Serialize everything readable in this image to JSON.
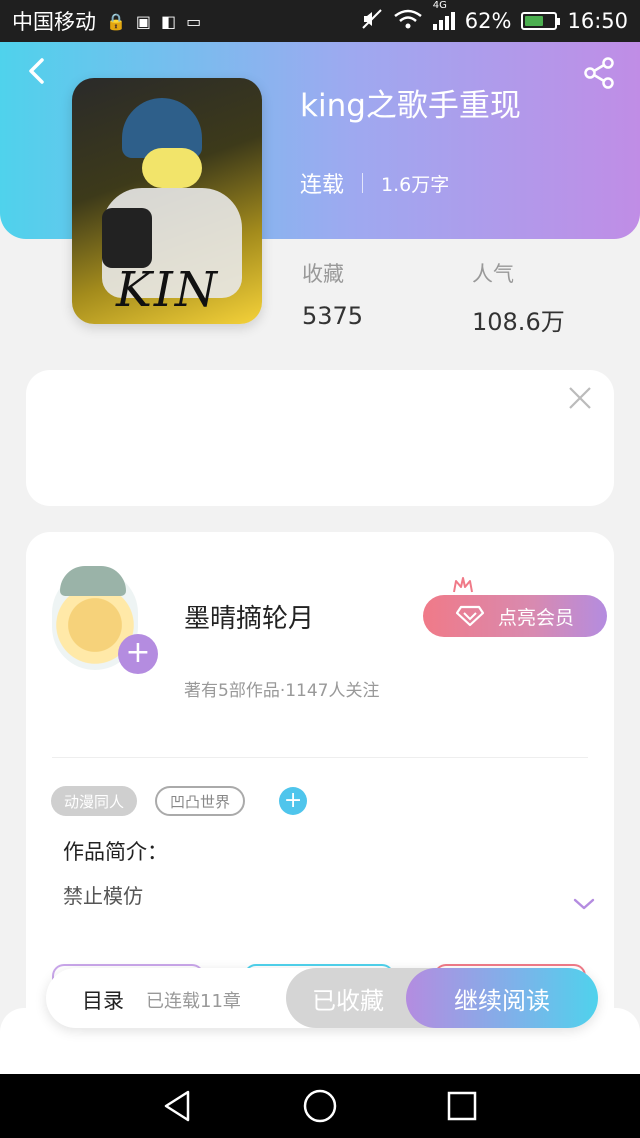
{
  "status_bar": {
    "carrier": "中国移动",
    "network": "4G",
    "battery": "62%",
    "battery_level": 0.62,
    "time": "16:50"
  },
  "header": {
    "back_icon": "back-arrow-icon",
    "share_icon": "share-icon",
    "title": "king之歌手重现",
    "status": "连载",
    "word_count": "1.6万字"
  },
  "stats": {
    "favorites_label": "收藏",
    "favorites_value": "5375",
    "popularity_label": "人气",
    "popularity_value": "108.6万"
  },
  "cover": {
    "text": "KIN"
  },
  "author": {
    "name": "墨晴摘轮月",
    "meta": "著有5部作品·1147人关注",
    "vip_label": "点亮会员"
  },
  "tags": [
    "动漫同人",
    "凹凸世界"
  ],
  "intro": {
    "title": "作品简介：",
    "text": "禁止模仿"
  },
  "bottom_bar": {
    "toc_label": "目录",
    "toc_count": "已连载11章",
    "collected_label": "已收藏",
    "read_label": "继续阅读"
  },
  "colors": {
    "gradient_start": "#4fd2ec",
    "gradient_end": "#c08de6",
    "vip_pink": "#f07a88",
    "accent_purple": "#b48ce0"
  }
}
